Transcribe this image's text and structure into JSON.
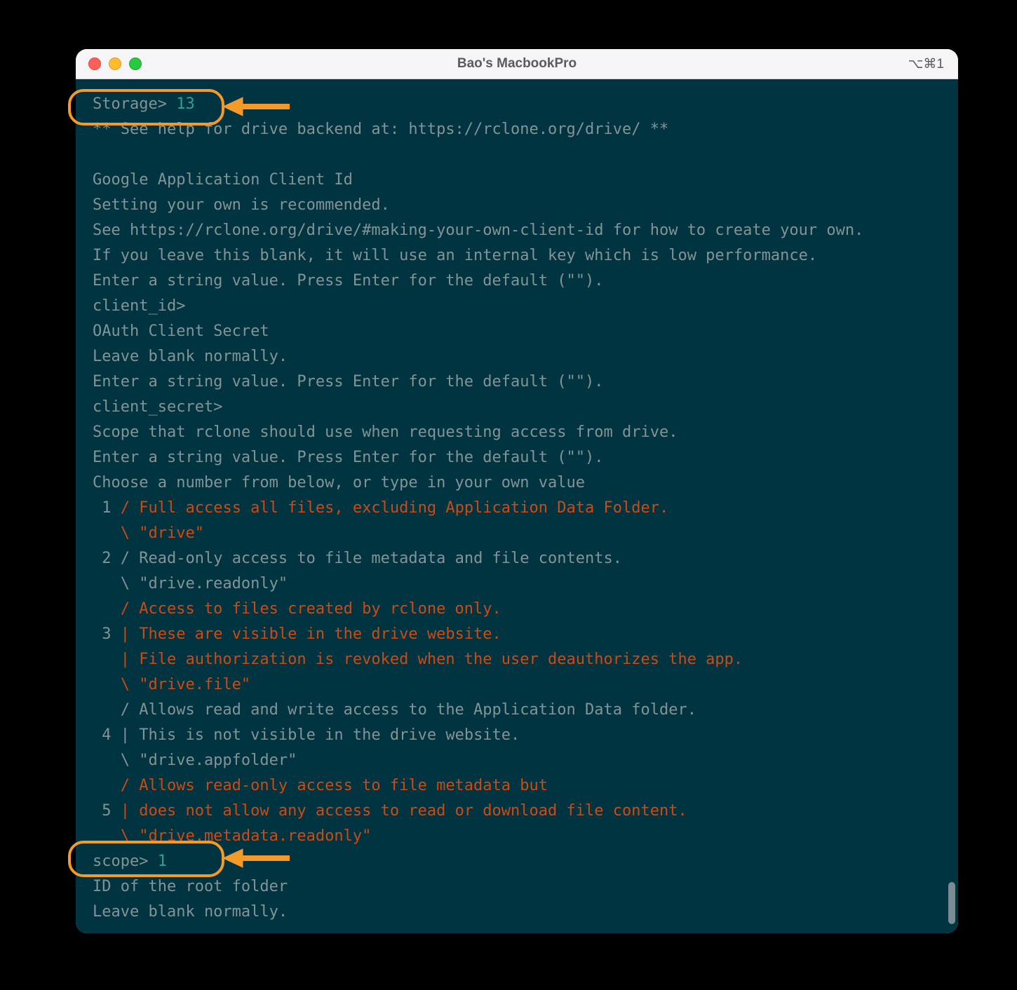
{
  "window": {
    "title": "Bao's MacbookPro",
    "hotkey": "⌥⌘1"
  },
  "terminal": {
    "prompt1_label": "Storage>",
    "prompt1_value": " 13",
    "help_line": "** See help for drive backend at: https://rclone.org/drive/ **",
    "client_id_heading": "Google Application Client Id",
    "client_id_l1": "Setting your own is recommended.",
    "client_id_l2": "See https://rclone.org/drive/#making-your-own-client-id for how to create your own.",
    "client_id_l3": "If you leave this blank, it will use an internal key which is low performance.",
    "enter_string": "Enter a string value. Press Enter for the default (\"\").",
    "client_id_prompt": "client_id>",
    "secret_heading": "OAuth Client Secret",
    "leave_blank": "Leave blank normally.",
    "client_secret_prompt": "client_secret>",
    "scope_desc": "Scope that rclone should use when requesting access from drive.",
    "choose_num": "Choose a number from below, or type in your own value",
    "opt1_num": " 1 ",
    "opt1_desc": "/ Full access all files, excluding Application Data Folder.",
    "opt1_val": "   \\ \"drive\"",
    "opt2_num": " 2 ",
    "opt2_desc": "/ Read-only access to file metadata and file contents.",
    "opt2_val": "   \\ \"drive.readonly\"",
    "opt3_l1": "   / Access to files created by rclone only.",
    "opt3_num": " 3 ",
    "opt3_l2": "| These are visible in the drive website.",
    "opt3_l3": "   | File authorization is revoked when the user deauthorizes the app.",
    "opt3_val": "   \\ \"drive.file\"",
    "opt4_l1": "   / Allows read and write access to the Application Data folder.",
    "opt4_num": " 4 ",
    "opt4_l2": "| This is not visible in the drive website.",
    "opt4_val": "   \\ \"drive.appfolder\"",
    "opt5_l1": "   / Allows read-only access to file metadata but",
    "opt5_num": " 5 ",
    "opt5_l2": "| does not allow any access to read or download file content.",
    "opt5_val": "   \\ \"drive.metadata.readonly\"",
    "scope_prompt": "scope>",
    "scope_value": " 1",
    "root_id": "ID of the root folder",
    "root_blank": "Leave blank normally."
  }
}
